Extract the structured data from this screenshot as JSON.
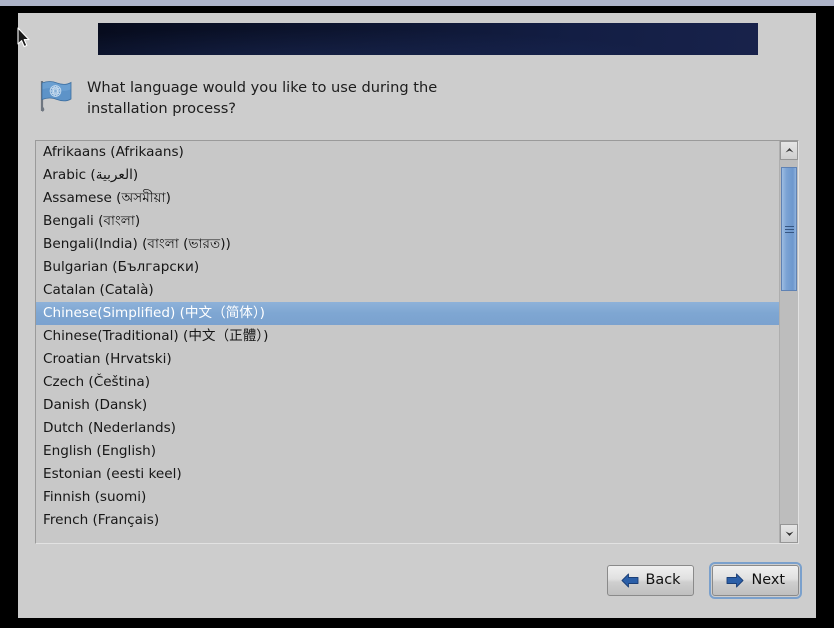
{
  "window": {
    "banner_title": "",
    "background_color": "#cdcdcd",
    "banner_color": "#0d1530",
    "selection_color": "#7ba2cf"
  },
  "header": {
    "icon": "un-flag-icon",
    "question": "What language would you like to use during the installation process?"
  },
  "language_list": {
    "selected_index": 7,
    "items": [
      "Afrikaans (Afrikaans)",
      "Arabic (العربية)",
      "Assamese (অসমীয়া)",
      "Bengali (বাংলা)",
      "Bengali(India) (বাংলা (ভারত))",
      "Bulgarian (Български)",
      "Catalan (Català)",
      "Chinese(Simplified) (中文（简体）)",
      "Chinese(Traditional) (中文（正體）)",
      "Croatian (Hrvatski)",
      "Czech (Čeština)",
      "Danish (Dansk)",
      "Dutch (Nederlands)",
      "English (English)",
      "Estonian (eesti keel)",
      "Finnish (suomi)",
      "French (Français)"
    ]
  },
  "scrollbar": {
    "up_arrow": "chevron-up-icon",
    "down_arrow": "chevron-down-icon",
    "thumb_position_percent": 2,
    "thumb_size_percent": 34
  },
  "footer": {
    "back_label": "Back",
    "back_icon": "arrow-left-icon",
    "next_label": "Next",
    "next_icon": "arrow-right-icon",
    "focused_button": "Next"
  },
  "cursor": {
    "icon": "mouse-pointer-icon"
  }
}
